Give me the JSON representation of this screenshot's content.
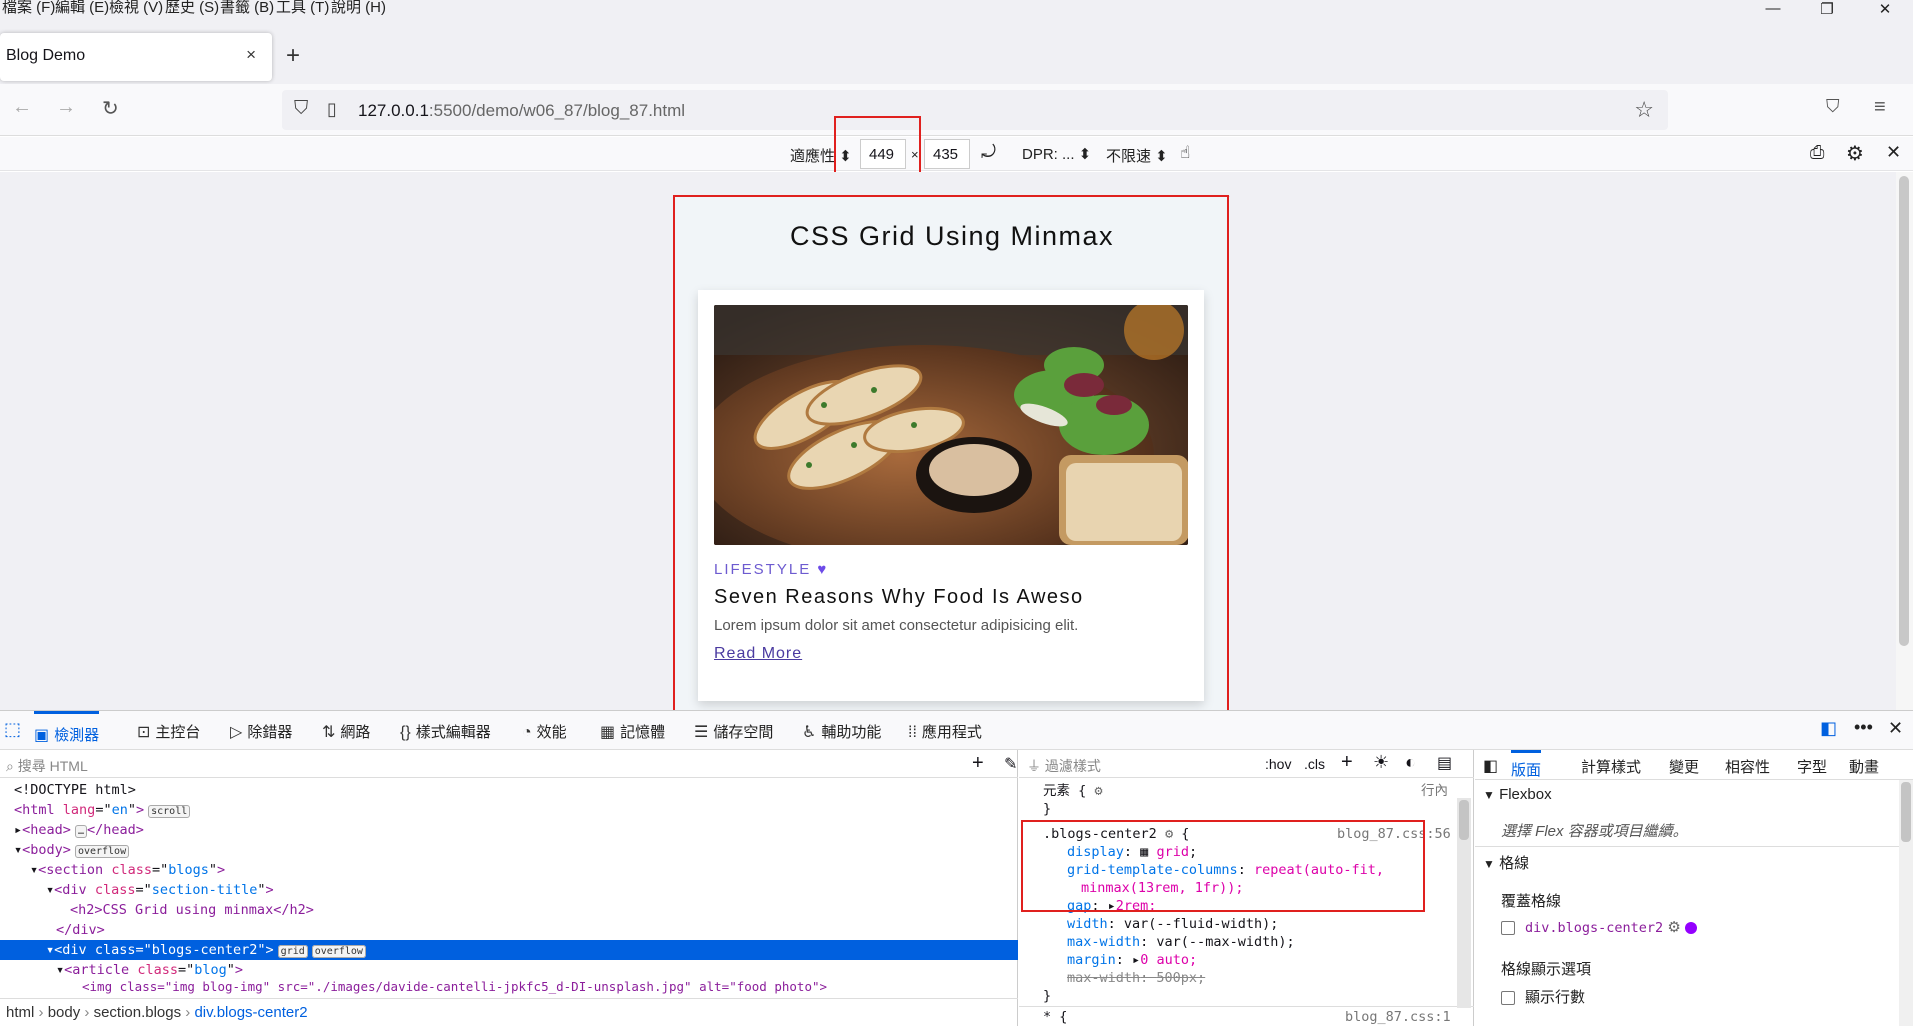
{
  "menubar": {
    "items": [
      "檔案 (F)",
      "編輯 (E)",
      "檢視 (V)",
      "歷史 (S)",
      "書籤 (B)",
      "工具 (T)",
      "說明 (H)"
    ]
  },
  "window": {
    "minimize": "—",
    "restore": "❐",
    "close": "✕"
  },
  "tab": {
    "title": "Blog Demo",
    "close": "×",
    "new_tab": "+"
  },
  "url": {
    "host": "127.0.0.1",
    "path": ":5500/demo/w06_87/blog_87.html"
  },
  "rdm": {
    "mode": "適應性",
    "width": "449",
    "times": "×",
    "height": "435",
    "dpr": "DPR: ...",
    "throttle": "不限速"
  },
  "page": {
    "title": "CSS Grid Using Minmax",
    "card": {
      "category": "LIFESTYLE",
      "heart": "♥",
      "title": "Seven Reasons Why Food Is Aweso",
      "desc": "Lorem ipsum dolor sit amet consectetur adipisicing elit.",
      "link": "Read More"
    }
  },
  "devtools": {
    "tabs": [
      "檢測器",
      "主控台",
      "除錯器",
      "網路",
      "樣式編輯器",
      "效能",
      "記憶體",
      "儲存空間",
      "輔助功能",
      "應用程式"
    ],
    "html_search_placeholder": "搜尋 HTML",
    "styles_filter_placeholder": "過濾樣式",
    "hov": ":hov",
    "cls": ".cls",
    "breadcrumbs": [
      "html",
      "body",
      "section.blogs",
      "div.blogs-center2"
    ],
    "layout_tabs": [
      "版面",
      "計算樣式",
      "變更",
      "相容性",
      "字型",
      "動畫"
    ],
    "flexbox_header": "Flexbox",
    "flexbox_hint": "選擇 Flex 容器或項目繼續。",
    "grid_header": "格線",
    "overlay_grid": "覆蓋格線",
    "grid_item": "div.blogs-center2",
    "grid_display_options": "格線顯示選項",
    "show_line_numbers": "顯示行數"
  },
  "html_tree": [
    {
      "text": "<!DOCTYPE html>"
    },
    {
      "tag": "html",
      "attr": "lang",
      "val": "en",
      "badge": "scroll"
    },
    {
      "tag": "head",
      "collapsed": "…",
      "close": "</head>"
    },
    {
      "tag": "body",
      "badge": "overflow"
    },
    {
      "tag": "section",
      "attr": "class",
      "val": "blogs"
    },
    {
      "tag": "div",
      "attr": "class",
      "val": "section-title"
    },
    {
      "text": "<h2>CSS Grid using minmax</h2>"
    },
    {
      "text": "</div>"
    },
    {
      "tag": "div",
      "attr": "class",
      "val": "blogs-center2",
      "badge": "grid",
      "badge2": "overflow"
    },
    {
      "tag": "article",
      "attr": "class",
      "val": "blog"
    },
    {
      "text": "<img class=\"img blog-img\" src=\"./images/davide-cantelli-jpkfc5_d-DI-unsplash.jpg\" alt=\"food photo\">"
    }
  ],
  "rules": {
    "element_selector": "元素 {",
    "element_close": "}",
    "inline": "行內",
    "selector": ".blogs-center2",
    "source": "blog_87.css:56",
    "decls": [
      {
        "p": "display",
        "v": "grid"
      },
      {
        "p": "grid-template-columns",
        "v": "repeat(auto-fit,"
      },
      {
        "p": "",
        "v": "minmax(13rem, 1fr));"
      },
      {
        "p": "gap",
        "v": "2rem;"
      },
      {
        "p": "width",
        "v": "var(--fluid-width);"
      },
      {
        "p": "max-width",
        "v": "var(--max-width);"
      },
      {
        "p": "margin",
        "v": "0 auto;"
      },
      {
        "p": "max-width",
        "v": "500px;"
      }
    ],
    "rule_close": "}",
    "next_selector": "* {",
    "next_source": "blog_87.css:1"
  }
}
